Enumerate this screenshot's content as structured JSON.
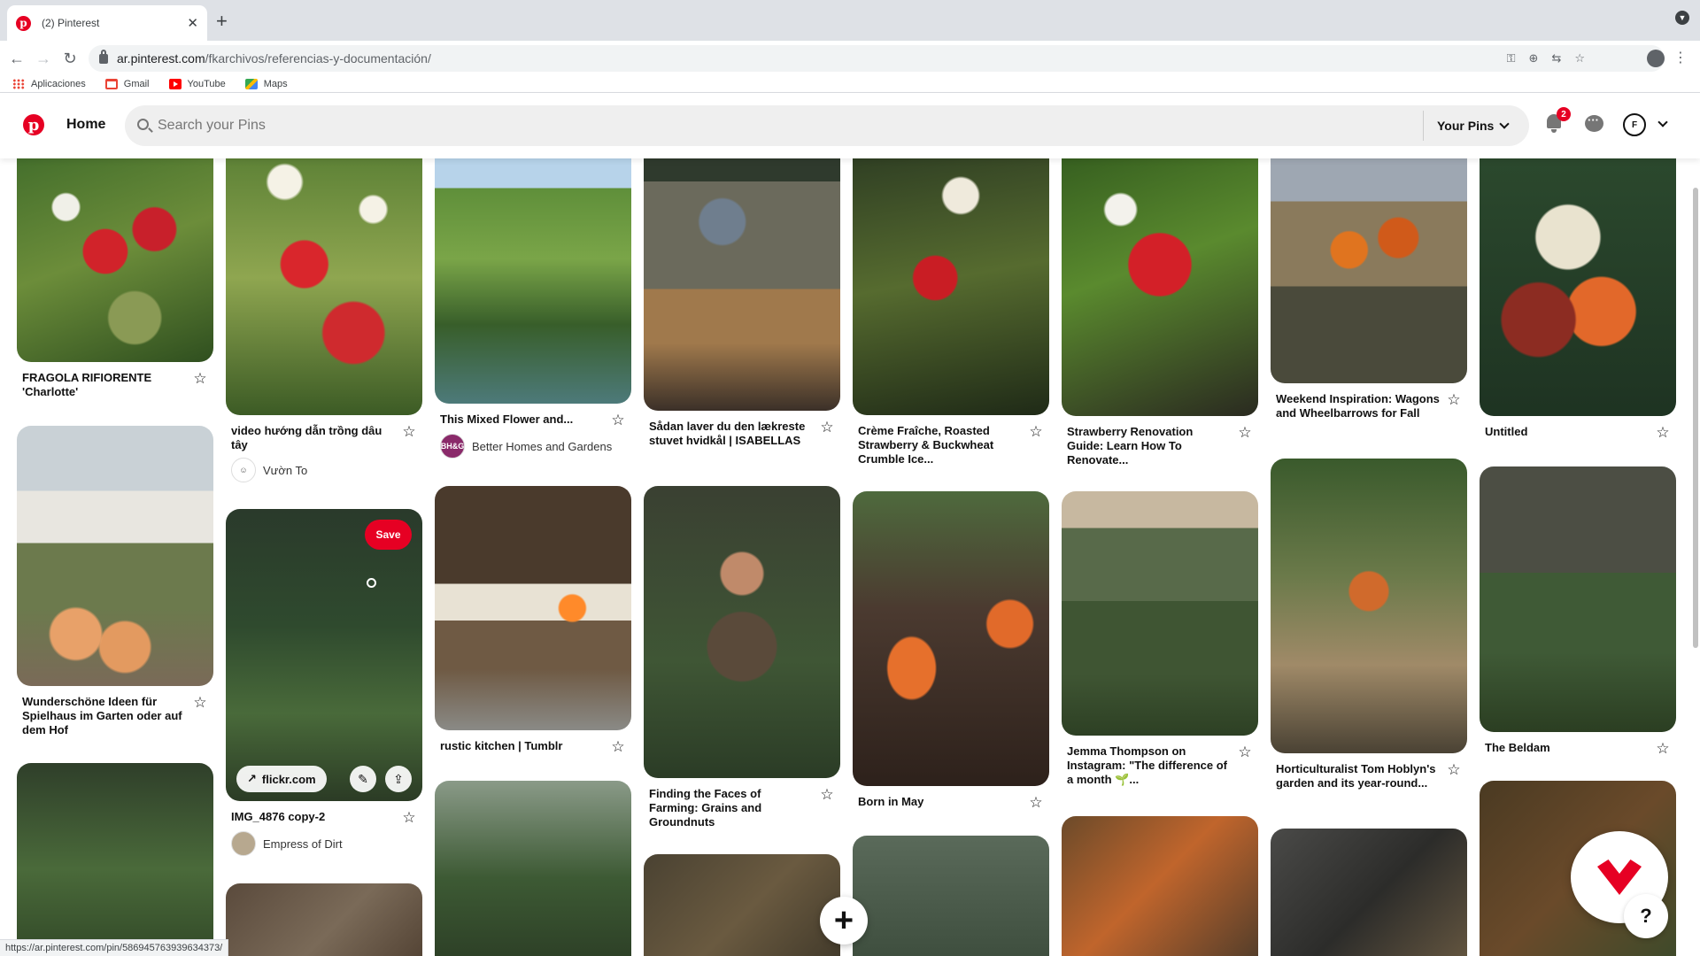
{
  "browser": {
    "tab_title": "(2) Pinterest",
    "url_host": "ar.pinterest.com",
    "url_path": "/fkarchivos/referencias-y-documentación/",
    "bookmarks": [
      "Aplicaciones",
      "Gmail",
      "YouTube",
      "Maps"
    ],
    "status_url": "https://ar.pinterest.com/pin/586945763939634373/"
  },
  "header": {
    "home_label": "Home",
    "search_placeholder": "Search your Pins",
    "your_pins_label": "Your Pins",
    "notification_count": "2",
    "avatar_initial": "F"
  },
  "colors": {
    "brand": "#e60023"
  },
  "pins": [
    {
      "title": "FRAGOLA RIFIORENTE 'Charlotte'"
    },
    {
      "title": "Wunderschöne Ideen für Spielhaus im Garten oder auf dem Hof"
    },
    {
      "title": "video hướng dẫn trồng dâu tây",
      "author": "Vườn To"
    },
    {
      "title": "IMG_4876 copy-2",
      "author": "Empress of Dirt",
      "save_label": "Save",
      "source": "flickr.com"
    },
    {
      "title": "This Mixed Flower and...",
      "author": "Better Homes and Gardens",
      "author_badge": "BH&G"
    },
    {
      "title": "rustic kitchen | Tumblr"
    },
    {
      "title": "Sådan laver du den lækreste stuvet hvidkål | ISABELLAS"
    },
    {
      "title": "Finding the Faces of Farming: Grains and Groundnuts"
    },
    {
      "title": "Crème Fraîche, Roasted Strawberry & Buckwheat Crumble Ice..."
    },
    {
      "title": "Born in May"
    },
    {
      "title": "Strawberry Renovation Guide: Learn How To Renovate..."
    },
    {
      "title": "Jemma Thompson on Instagram: \"The difference of a month 🌱..."
    },
    {
      "title": "Weekend Inspiration: Wagons and Wheelbarrows for Fall"
    },
    {
      "title": "Horticulturalist Tom Hoblyn's garden and its year-round..."
    },
    {
      "title": "Untitled"
    },
    {
      "title": "The Beldam"
    }
  ]
}
